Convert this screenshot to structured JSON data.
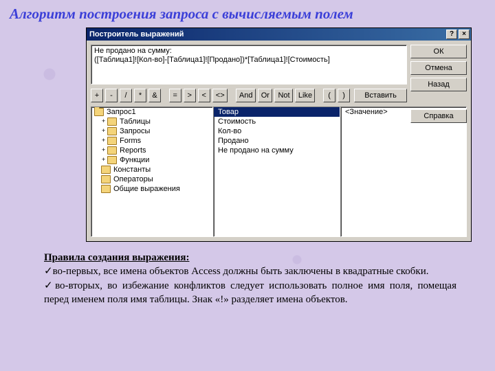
{
  "page_title": "Алгоритм построения запроса с вычисляемым полем",
  "dialog": {
    "title": "Построитель выражений",
    "help_btn": "?",
    "close_btn": "×",
    "expression": "Не продано на сумму:\n([Таблица1]![Кол-во]-[Таблица1]![Продано])*[Таблица1]![Стоимость]",
    "buttons": {
      "ok": "ОК",
      "cancel": "Отмена",
      "back": "Назад",
      "insert": "Вставить",
      "help": "Справка"
    },
    "ops": [
      "+",
      "-",
      "/",
      "*",
      "&",
      "=",
      ">",
      "<",
      "<>",
      "And",
      "Or",
      "Not",
      "Like",
      "(",
      ")"
    ],
    "tree": [
      {
        "label": "Запрос1",
        "open": true,
        "sel": false,
        "indent": 0
      },
      {
        "label": "Таблицы",
        "open": false,
        "plus": true,
        "indent": 1
      },
      {
        "label": "Запросы",
        "open": false,
        "plus": true,
        "indent": 1
      },
      {
        "label": "Forms",
        "open": false,
        "plus": true,
        "indent": 1
      },
      {
        "label": "Reports",
        "open": false,
        "plus": true,
        "indent": 1
      },
      {
        "label": "Функции",
        "open": false,
        "plus": true,
        "indent": 1
      },
      {
        "label": "Константы",
        "open": false,
        "indent": 1
      },
      {
        "label": "Операторы",
        "open": false,
        "indent": 1
      },
      {
        "label": "Общие выражения",
        "open": false,
        "indent": 1
      }
    ],
    "fields": [
      "Товар",
      "Стоимость",
      "Кол-во",
      "Продано",
      "Не продано на сумму"
    ],
    "fields_sel": 0,
    "values": [
      "<Значение>"
    ]
  },
  "rules": {
    "heading": "Правила создания выражения:",
    "r1": "во-первых, все имена объектов Access должны быть заключены в квадратные скобки.",
    "r2": "во-вторых, во избежание конфликтов следует использовать полное имя поля, помещая перед именем поля имя таблицы. Знак «!» разделяет имена объектов."
  }
}
